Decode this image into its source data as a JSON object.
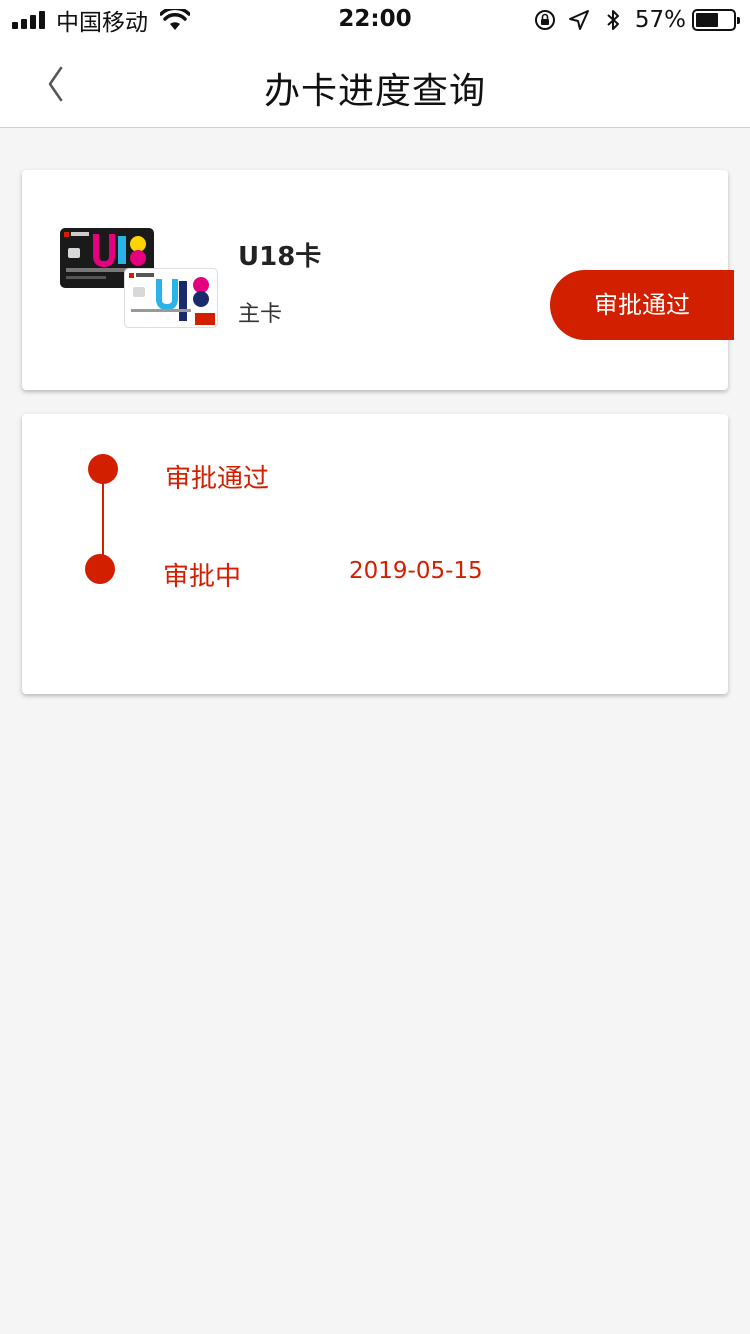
{
  "status_bar": {
    "carrier": "中国移动",
    "time": "22:00",
    "battery": "57%",
    "battery_level": 0.57
  },
  "nav": {
    "title": "办卡进度查询",
    "back_icon": "chevron-left-icon"
  },
  "card": {
    "name": "U18卡",
    "type": "主卡",
    "status": "审批通过"
  },
  "progress": [
    {
      "label": "审批通过",
      "date": ""
    },
    {
      "label": "审批中",
      "date": "2019-05-15"
    }
  ],
  "colors": {
    "accent": "#d21f00",
    "background": "#f5f5f5"
  }
}
